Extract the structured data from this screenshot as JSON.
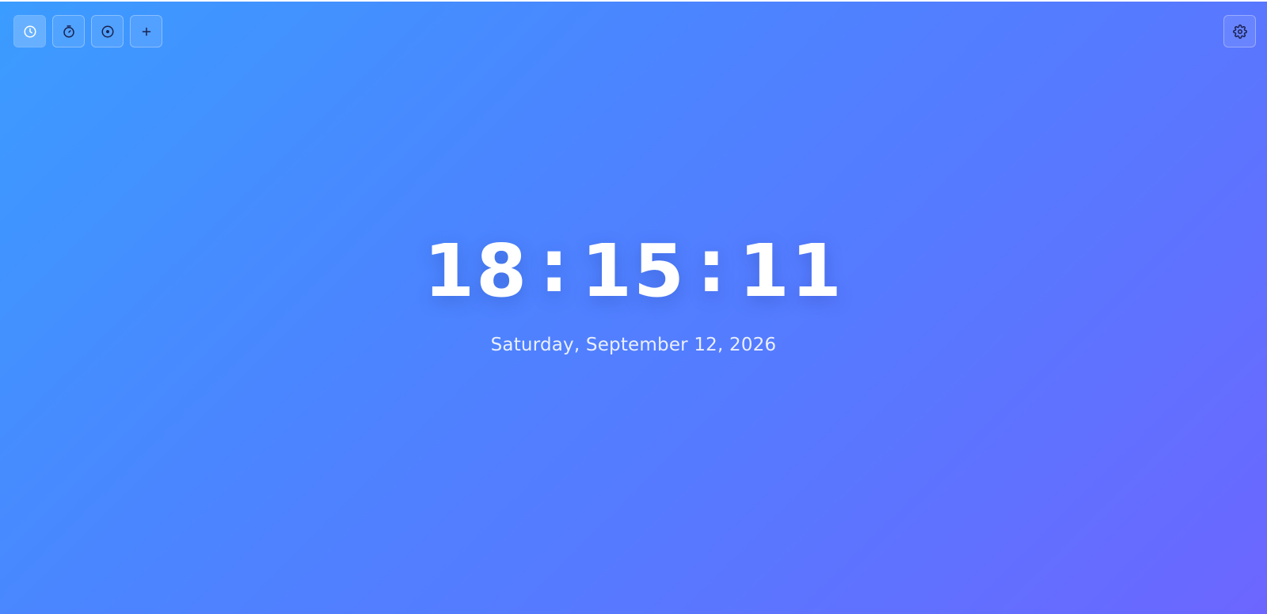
{
  "toolbar": {
    "buttons": [
      {
        "name": "clock",
        "icon": "clock-icon",
        "active": true
      },
      {
        "name": "stopwatch",
        "icon": "stopwatch-icon",
        "active": false
      },
      {
        "name": "timer",
        "icon": "timer-icon",
        "active": false
      },
      {
        "name": "add",
        "icon": "plus-icon",
        "active": false
      }
    ],
    "settings_icon": "gear-icon"
  },
  "clock": {
    "hours": "18",
    "minutes": "15",
    "seconds": "11",
    "separator": ":"
  },
  "date": "Saturday, September 12, 2026",
  "colors": {
    "gradient_start": "#3b9cff",
    "gradient_end": "#6c66ff",
    "text": "#ffffff",
    "icon": "#1a2250"
  }
}
